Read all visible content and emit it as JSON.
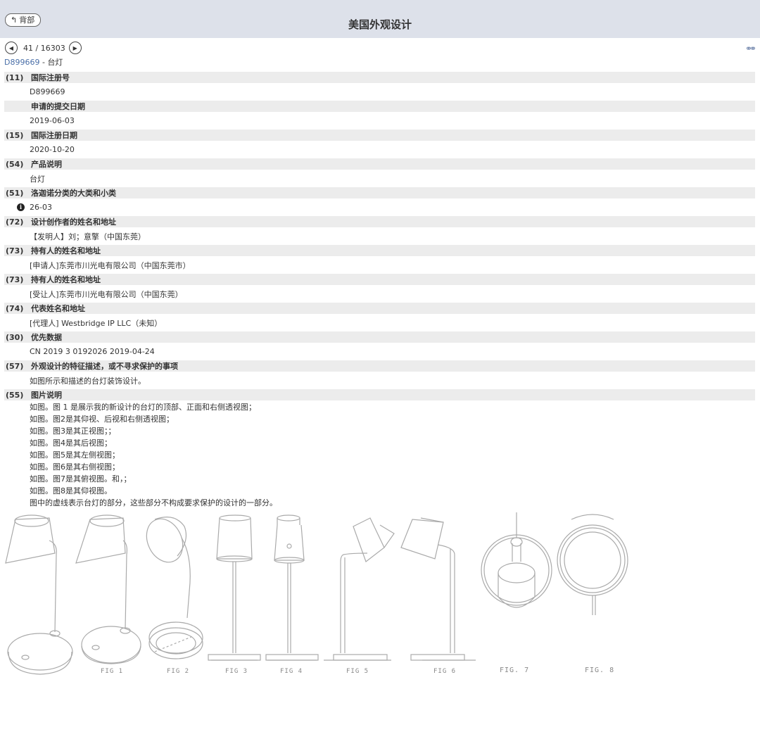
{
  "header": {
    "back_label": "背部",
    "title": "美国外观设计"
  },
  "pager": {
    "position": "41 / 16303"
  },
  "doc": {
    "reg_no": "D899669",
    "subtitle_sep": " - ",
    "product": "台灯"
  },
  "fields": [
    {
      "code": "(11)",
      "label": "国际注册号",
      "value": "D899669"
    },
    {
      "code": "",
      "label": "申请的提交日期",
      "value": "2019-06-03"
    },
    {
      "code": "(15)",
      "label": "国际注册日期",
      "value": "2020-10-20"
    },
    {
      "code": "(54)",
      "label": "产品说明",
      "value": "台灯"
    },
    {
      "code": "(51)",
      "label": "洛迦诺分类的大类和小类",
      "value": "26-03"
    },
    {
      "code": "(72)",
      "label": "设计创作者的姓名和地址",
      "value": "【发明人】刘；意擎（中国东莞）"
    },
    {
      "code": "(73)",
      "label": "持有人的姓名和地址",
      "value": "[申请人]东莞市川光电有限公司（中国东莞市）"
    },
    {
      "code": "(73)",
      "label": "持有人的姓名和地址",
      "value": "[受让人]东莞市川光电有限公司（中国东莞）"
    },
    {
      "code": "(74)",
      "label": "代表姓名和地址",
      "value": "[代理人] Westbridge IP LLC（未知）"
    },
    {
      "code": "(30)",
      "label": "优先数据",
      "value": "CN 2019 3 0192026 2019-04-24"
    },
    {
      "code": "(57)",
      "label": "外观设计的特征描述，或不寻求保护的事项",
      "value": "如图所示和描述的台灯装饰设计。"
    },
    {
      "code": "(55)",
      "label": "图片说明"
    }
  ],
  "image_description": [
    "如图。图 1 是展示我的新设计的台灯的顶部、正面和右侧透视图；",
    "如图。图2是其仰视、后视和右侧透视图；",
    "如图。图3是其正视图；；",
    "如图。图4是其后视图；",
    "如图。图5是其左侧视图；",
    "如图。图6是其右侧视图；",
    "如图。图7是其俯视图。和，；",
    "如图。图8是其仰视图。",
    "图中的虚线表示台灯的部分，这些部分不构成要求保护的设计的一部分。"
  ],
  "figure_labels": [
    "FIG 1",
    "FIG 2",
    "FIG 3",
    "FIG 4",
    "FIG 5",
    "FIG 6",
    "FIG. 7",
    "FIG. 8"
  ],
  "icons": {
    "back": "back-arrow-icon",
    "prev": "prev-page-icon",
    "next": "next-page-icon",
    "link": "link-icon",
    "info": "info-icon"
  }
}
